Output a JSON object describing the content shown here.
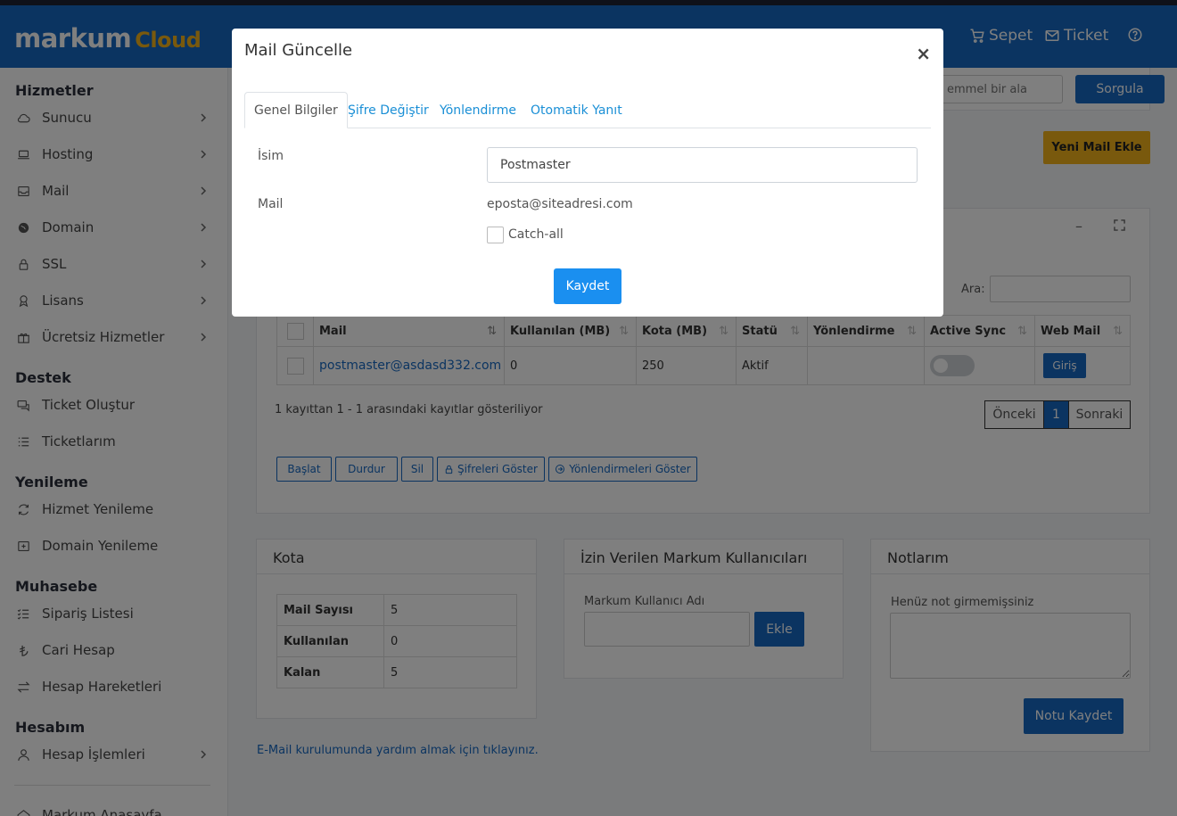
{
  "brand": {
    "logo_main": "markum",
    "logo_sub": "Cloud"
  },
  "topnav": {
    "cart_label": "Sepet",
    "ticket_label": "Ticket"
  },
  "sidebar": {
    "sections": [
      "Hizmetler",
      "Destek",
      "Yenileme",
      "Muhasebe",
      "Hesabım"
    ],
    "items": [
      {
        "label": "Sunucu"
      },
      {
        "label": "Hosting"
      },
      {
        "label": "Mail"
      },
      {
        "label": "Domain"
      },
      {
        "label": "SSL"
      },
      {
        "label": "Lisans"
      },
      {
        "label": "Ücretsiz Hizmetler"
      },
      {
        "label": "Ticket Oluştur"
      },
      {
        "label": "Ticketlarım"
      },
      {
        "label": "Hizmet Yenileme"
      },
      {
        "label": "Domain Yenileme"
      },
      {
        "label": "Sipariş Listesi"
      },
      {
        "label": "Cari Hesap"
      },
      {
        "label": "Hesap Hareketleri"
      },
      {
        "label": "Hesap İşlemleri"
      },
      {
        "label": "Markum Anasayfa"
      }
    ]
  },
  "search": {
    "placeholder": "emmel bir ala",
    "button": "Sorgula"
  },
  "new_mail_button": "Yeni Mail Ekle",
  "mail_table": {
    "search_label": "Ara:",
    "columns": [
      "Mail",
      "Kullanılan (MB)",
      "Kota (MB)",
      "Statü",
      "Yönlendirme",
      "Active Sync",
      "Web Mail"
    ],
    "rows": [
      {
        "mail": "postmaster@asdasd332.com",
        "used": "0",
        "quota": "250",
        "status": "Aktif",
        "redirect": "",
        "webmail": "Giriş"
      }
    ],
    "info": "1 kayıttan 1 - 1 arasındaki kayıtlar gösteriliyor",
    "pagination": {
      "prev": "Önceki",
      "page": "1",
      "next": "Sonraki"
    },
    "actions": [
      "Başlat",
      "Durdur",
      "Sil",
      "Şifreleri Göster",
      "Yönlendirmeleri Göster"
    ]
  },
  "kota": {
    "title": "Kota",
    "rows": [
      {
        "label": "Mail Sayısı",
        "value": "5"
      },
      {
        "label": "Kullanılan",
        "value": "0"
      },
      {
        "label": "Kalan",
        "value": "5"
      }
    ]
  },
  "allowed_users": {
    "title": "İzin Verilen Markum Kullanıcıları",
    "field_label": "Markum Kullanıcı Adı",
    "button": "Ekle"
  },
  "notes": {
    "title": "Notlarım",
    "placeholder": "Henüz not girmemişsiniz",
    "button": "Notu Kaydet"
  },
  "help_link": "E-Mail kurulumunda yardım almak için tıklayınız.",
  "modal": {
    "title": "Mail Güncelle",
    "close": "×",
    "tabs": [
      "Genel Bilgiler",
      "Şifre Değiştir",
      "Yönlendirme",
      "Otomatik Yanıt"
    ],
    "name_label": "İsim",
    "name_value": "Postmaster",
    "mail_label": "Mail",
    "mail_value": "eposta@siteadresi.com",
    "catchall_label": "Catch-all",
    "save": "Kaydet"
  }
}
